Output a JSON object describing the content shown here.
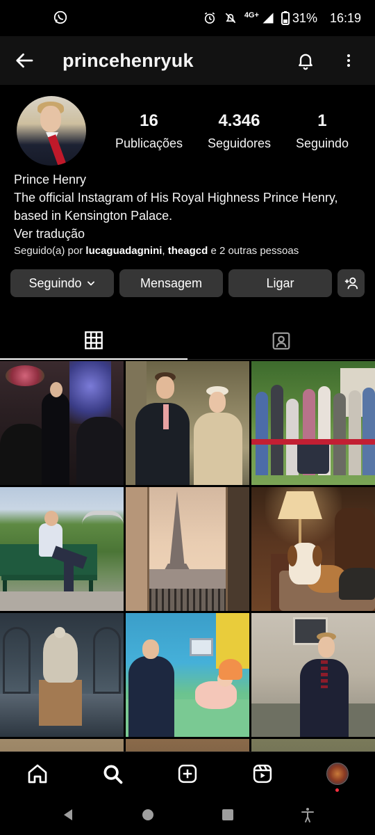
{
  "status_bar": {
    "battery": "31%",
    "time": "16:19",
    "network": "4G+",
    "icons": [
      "whatsapp-icon",
      "alarm-icon",
      "mute-icon",
      "signal-icon",
      "battery-icon"
    ]
  },
  "header": {
    "username": "princehenryuk",
    "icons": [
      "back-arrow-icon",
      "bell-icon",
      "more-vertical-icon"
    ]
  },
  "profile": {
    "stats": [
      {
        "value": "16",
        "label": "Publicações"
      },
      {
        "value": "4.346",
        "label": "Seguidores"
      },
      {
        "value": "1",
        "label": "Seguindo"
      }
    ],
    "name": "Prince Henry",
    "bio": "The official Instagram of His Royal Highness Prince Henry, based in Kensington Palace.",
    "translate": "Ver tradução",
    "followed_by": {
      "prefix": "Seguido(a) por ",
      "user1": "lucaguadagnini",
      "sep": ", ",
      "user2": "theagcd",
      "suffix": " e 2 outras pessoas"
    }
  },
  "actions": {
    "following": "Seguindo",
    "message": "Mensagem",
    "call": "Ligar"
  },
  "tabs": {
    "icons": [
      "grid-icon",
      "tagged-icon"
    ],
    "active": "grid"
  },
  "bottom_nav": {
    "icons": [
      "home-icon",
      "search-icon",
      "create-icon",
      "reels-icon",
      "profile-avatar"
    ]
  },
  "system_nav": {
    "icons": [
      "back-triangle-icon",
      "home-circle-icon",
      "recents-square-icon",
      "accessibility-icon"
    ]
  },
  "colors": {
    "background": "#000000",
    "header_bg": "#121212",
    "button_bg": "#363636",
    "notification_dot": "#ff3040"
  }
}
